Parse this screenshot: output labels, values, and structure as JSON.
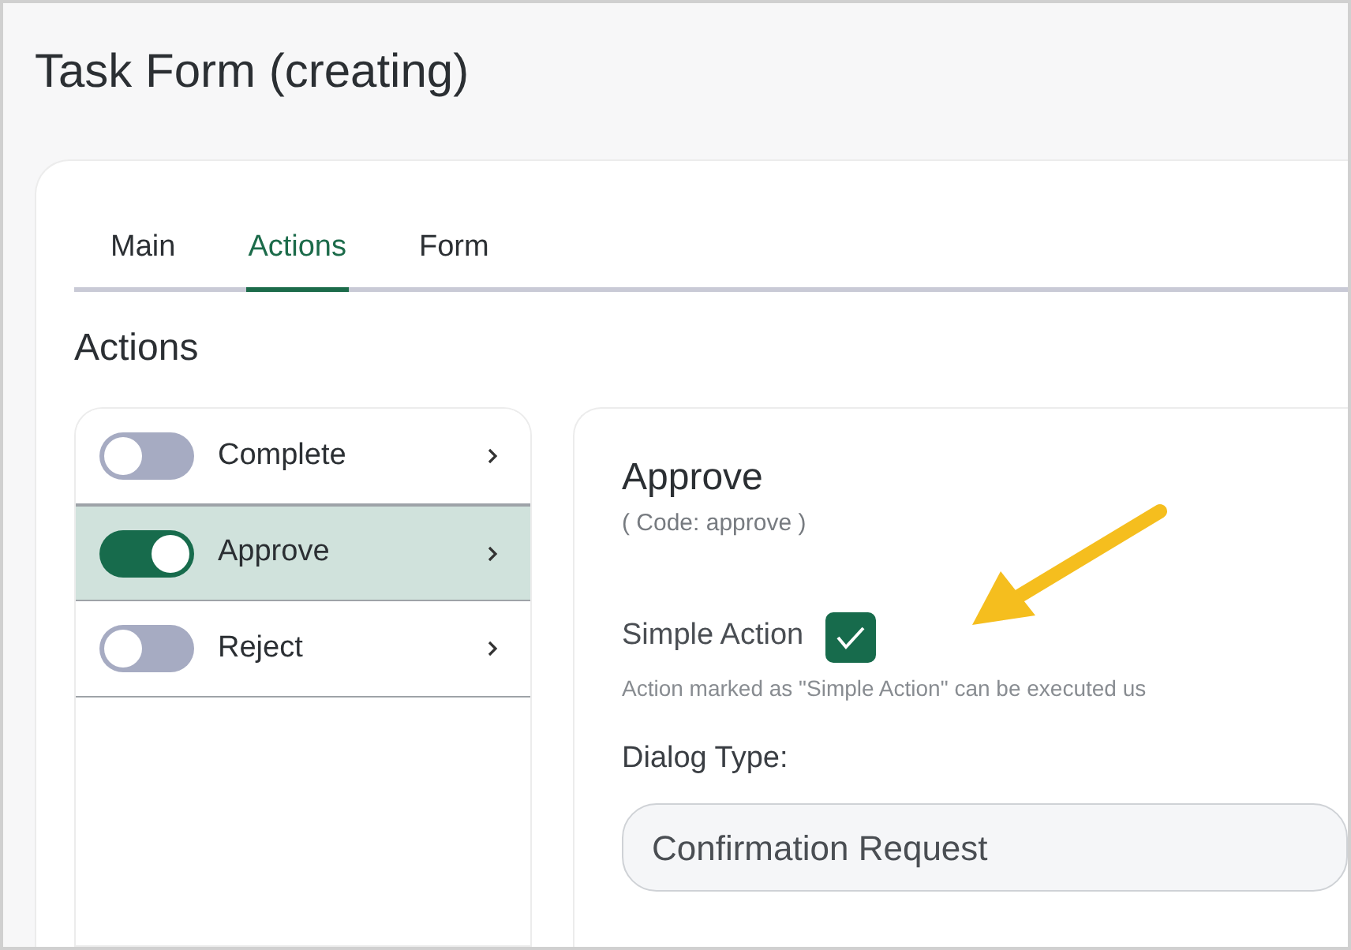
{
  "page": {
    "title": "Task Form (creating)"
  },
  "tabs": [
    {
      "label": "Main",
      "selected": false
    },
    {
      "label": "Actions",
      "selected": true
    },
    {
      "label": "Form",
      "selected": false
    }
  ],
  "section_title": "Actions",
  "actions": [
    {
      "label": "Complete",
      "on": false,
      "selected": false
    },
    {
      "label": "Approve",
      "on": true,
      "selected": true
    },
    {
      "label": "Reject",
      "on": false,
      "selected": false
    }
  ],
  "detail": {
    "title": "Approve",
    "code": "( Code: approve )",
    "simple_action": {
      "label": "Simple Action",
      "checked": true,
      "hint": "Action marked as \"Simple Action\" can be executed us"
    },
    "dialog_type": {
      "label": "Dialog Type:",
      "value": "Confirmation Request"
    }
  }
}
